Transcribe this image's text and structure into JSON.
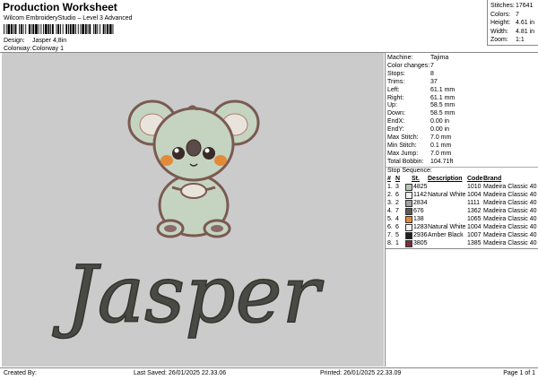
{
  "header": {
    "title": "Production Worksheet",
    "subtitle": "Wilcom EmbroideryStudio – Level 3 Advanced",
    "design_label": "Design:",
    "design_value": "Jasper 4,8in",
    "colorway_label": "Colorway:",
    "colorway_value": "Colorway 1"
  },
  "stats": [
    {
      "label": "Stitches:",
      "value": "17641"
    },
    {
      "label": "Colors:",
      "value": "7"
    },
    {
      "label": "Height:",
      "value": "4.61 in"
    },
    {
      "label": "Width:",
      "value": "4.81 in"
    },
    {
      "label": "Zoom:",
      "value": "1:1"
    }
  ],
  "preview": {
    "text": "Jasper",
    "colors": {
      "background": "#cbcbcb",
      "outline": "#7a5a52",
      "body": "#c5d4c0",
      "cheek": "#e3893a",
      "thread_dark": "#4a4a45",
      "brown": "#b07a6a"
    }
  },
  "machine": [
    {
      "label": "Machine:",
      "value": "Tajima"
    },
    {
      "label": "Color changes:",
      "value": "7"
    },
    {
      "label": "Stops:",
      "value": "8"
    },
    {
      "label": "Trims:",
      "value": "37"
    },
    {
      "label": "Left:",
      "value": "61.1 mm"
    },
    {
      "label": "Right:",
      "value": "61.1 mm"
    },
    {
      "label": "Up:",
      "value": "58.5 mm"
    },
    {
      "label": "Down:",
      "value": "58.5 mm"
    },
    {
      "label": "EndX:",
      "value": "0.00 in"
    },
    {
      "label": "EndY:",
      "value": "0.00 in"
    },
    {
      "label": "Max Stitch:",
      "value": "7.0 mm"
    },
    {
      "label": "Min Stitch:",
      "value": "0.1 mm"
    },
    {
      "label": "Max Jump:",
      "value": "7.0 mm"
    },
    {
      "label": "Total Bobbin:",
      "value": "104.71ft"
    }
  ],
  "stop_sequence": {
    "title": "Stop Sequence:",
    "headers": {
      "num": "#",
      "n": "N",
      "st": "St.",
      "description": "Description",
      "code": "Code",
      "brand": "Brand"
    },
    "rows": [
      {
        "num": "1.",
        "n": "3",
        "st": "4825",
        "description": "",
        "code": "1010",
        "brand": "Madeira Classic 40",
        "color": "#b7c6b0"
      },
      {
        "num": "2.",
        "n": "6",
        "st": "1142",
        "description": "Natural White",
        "code": "1004",
        "brand": "Madeira Classic 40",
        "color": "#f2f2ee"
      },
      {
        "num": "3.",
        "n": "2",
        "st": "2834",
        "description": "",
        "code": "1111",
        "brand": "Madeira Classic 40",
        "color": "#a0a0a0"
      },
      {
        "num": "4.",
        "n": "7",
        "st": "676",
        "description": "",
        "code": "1362",
        "brand": "Madeira Classic 40",
        "color": "#5a5a5a"
      },
      {
        "num": "5.",
        "n": "4",
        "st": "138",
        "description": "",
        "code": "1065",
        "brand": "Madeira Classic 40",
        "color": "#e3893a"
      },
      {
        "num": "6.",
        "n": "6",
        "st": "1283",
        "description": "Natural White",
        "code": "1004",
        "brand": "Madeira Classic 40",
        "color": "#f2f2ee"
      },
      {
        "num": "7.",
        "n": "5",
        "st": "2936",
        "description": "Amber Black",
        "code": "1007",
        "brand": "Madeira Classic 40",
        "color": "#1e1e1e"
      },
      {
        "num": "8.",
        "n": "1",
        "st": "3805",
        "description": "",
        "code": "1385",
        "brand": "Madeira Classic 40",
        "color": "#7a2f36"
      }
    ]
  },
  "footer": {
    "created": "Created By:",
    "saved": "Last Saved: 26/01/2025 22.33.06",
    "printed": "Printed: 26/01/2025 22.33.09",
    "page": "Page 1 of 1"
  }
}
